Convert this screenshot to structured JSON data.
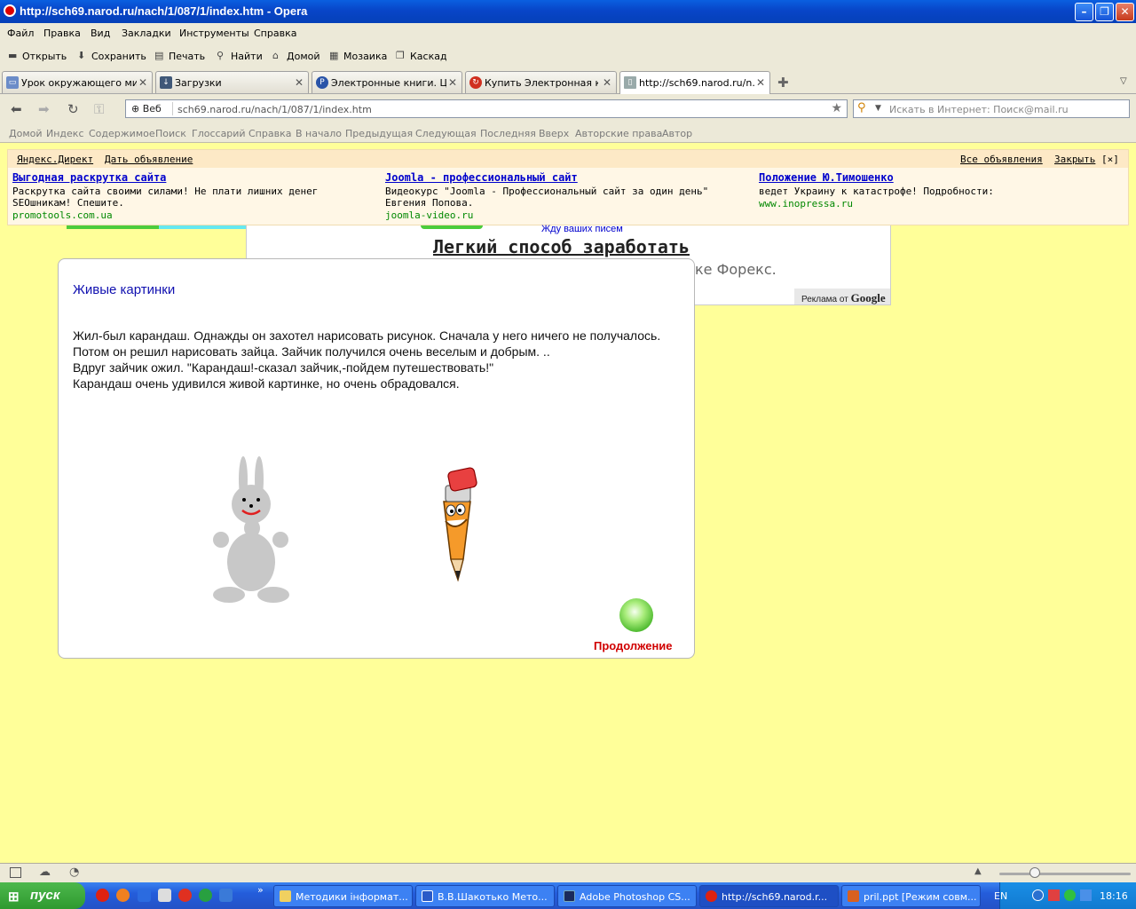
{
  "window": {
    "title": "http://sch69.narod.ru/nach/1/087/1/index.htm - Opera"
  },
  "menu": [
    "Файл",
    "Правка",
    "Вид",
    "Закладки",
    "Инструменты",
    "Справка"
  ],
  "toolbar": [
    "Открыть",
    "Сохранить",
    "Печать",
    "Найти",
    "Домой",
    "Мозаика",
    "Каскад"
  ],
  "tabs": [
    {
      "label": "Урок окружающего ми..."
    },
    {
      "label": "Загрузки"
    },
    {
      "label": "Электронные книги. Ц..."
    },
    {
      "label": "Купить Электронная к..."
    },
    {
      "label": "http://sch69.narod.ru/n..."
    }
  ],
  "address": {
    "web_label": "Веб",
    "url": "sch69.narod.ru/nach/1/087/1/index.htm"
  },
  "search": {
    "placeholder": "Искать в Интернет: Поиск@mail.ru"
  },
  "navbar": [
    "Домой",
    "Индекс",
    "Содержимое",
    "Поиск",
    "Глоссарий",
    "Справка",
    "В начало",
    "Предыдущая",
    "Следующая",
    "Последняя",
    "Вверх",
    "Авторские права",
    "Автор"
  ],
  "ads": {
    "header_left": [
      "Яндекс.Директ",
      "Дать объявление"
    ],
    "header_right": [
      "Все объявления",
      "Закрыть"
    ],
    "close_mark": "[×]",
    "items": [
      {
        "title": "Выгодная раскрутка сайта",
        "text": "Раскрутка сайта своими силами! Не плати лишних денег SEOшникам! Спешите.",
        "url": "promotools.com.ua"
      },
      {
        "title": "Joomla - профессиональный сайт",
        "text": "Видеокурс \"Joomla - Профессиональный сайт за один день\" Евгения Попова.",
        "url": "joomla-video.ru"
      },
      {
        "title": "Положение Ю.Тимошенко",
        "text": "ведет Украину к катастрофе! Подробности:",
        "url": "www.inopressa.ru"
      }
    ]
  },
  "google_ad": {
    "wait": "Жду ваших писем",
    "headline": "Легкий способ заработать",
    "forex": "ке Форекс.",
    "badge_prefix": "Реклама от",
    "badge_brand": "Google"
  },
  "lesson": {
    "title": "Живые картинки",
    "lines": [
      "Жил-был карандаш. Однажды он захотел нарисовать рисунок. Сначала у него ничего не получалось. Потом он решил нарисовать зайца. Зайчик получился очень веселым и добрым. ..",
      "Вдруг зайчик ожил. \"Карандаш!-сказал зайчик,-пойдем путешествовать!\"",
      "Карандаш очень удивился живой картинке, но очень обрадовался."
    ],
    "continue": "Продолжение"
  },
  "taskbar": {
    "start": "пуск",
    "tasks": [
      {
        "label": "Методики інформат..."
      },
      {
        "label": "В.В.Шакотько Мето..."
      },
      {
        "label": "Adobe Photoshop CS..."
      },
      {
        "label": "http://sch69.narod.r..."
      },
      {
        "label": "pril.ppt [Режим совм..."
      }
    ],
    "lang": "EN",
    "clock": "18:16"
  },
  "colors": {
    "page_bg": "#ffff99",
    "title_blue": "#1010b0",
    "continue_red": "#d00000",
    "ad_link": "#0000cc",
    "ad_url": "#008800"
  }
}
